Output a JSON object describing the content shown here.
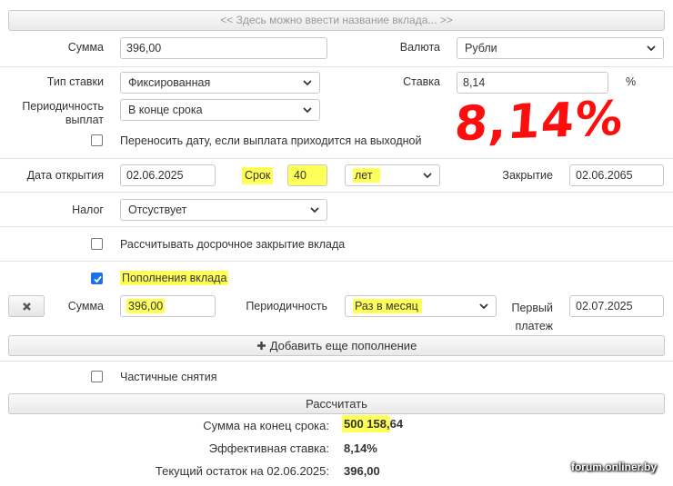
{
  "deposit_name": {
    "placeholder": "<< Здесь можно ввести название вклада... >>"
  },
  "amount": {
    "label": "Сумма",
    "value": "396,00"
  },
  "currency": {
    "label": "Валюта",
    "value": "Рубли"
  },
  "rate_type": {
    "label": "Тип ставки",
    "value": "Фиксированная"
  },
  "rate": {
    "label": "Ставка",
    "value": "8,14",
    "unit": "%"
  },
  "payout": {
    "label_line1": "Периодичность",
    "label_line2": "выплат",
    "value": "В конце срока"
  },
  "annotation": {
    "text": "8,14%"
  },
  "move_date": {
    "label": "Переносить дату, если выплата приходится на выходной",
    "checked": false
  },
  "open_date": {
    "label": "Дата открытия",
    "value": "02.06.2025"
  },
  "term": {
    "label": "Срок",
    "value": "40",
    "unit": "лет"
  },
  "close_date": {
    "label": "Закрытие",
    "value": "02.06.2065"
  },
  "tax": {
    "label": "Налог",
    "value": "Отсуствует"
  },
  "early_close": {
    "label": "Рассчитывать досрочное закрытие вклада",
    "checked": false
  },
  "replenish": {
    "label": "Пополнения вклада",
    "checked": true,
    "amount_label": "Сумма",
    "amount_value": "396,00",
    "period_label": "Периодичность",
    "period_value": "Раз в месяц",
    "first_label_line1": "Первый",
    "first_label_line2": "платеж",
    "first_value": "02.07.2025",
    "remove_icon": "x-icon",
    "add_label": "Добавить еще пополнение"
  },
  "withdrawals": {
    "label": "Частичные снятия",
    "checked": false
  },
  "calculate": {
    "label": "Рассчитать"
  },
  "results": {
    "end_sum_label": "Сумма на конец срока:",
    "end_sum_highlight": "500 158,",
    "end_sum_rest": "64",
    "eff_rate_label": "Эффективная ставка:",
    "eff_rate_value": "8,14%",
    "balance_label": "Текущий остаток на 02.06.2025:",
    "balance_value": "396,00"
  },
  "watermark": "forum.onliner.by",
  "colors": {
    "highlight": "#ffff5a",
    "annotation": "#ff0d0d",
    "checkbox": "#1a73e8"
  }
}
